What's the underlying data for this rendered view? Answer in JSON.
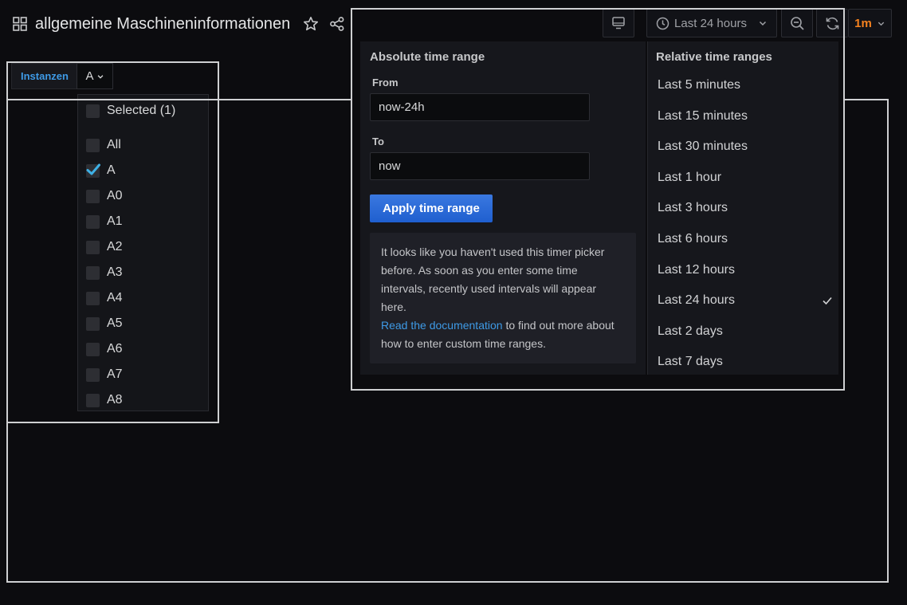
{
  "dashboard": {
    "title": "allgemeine Maschineninformationen",
    "icons": [
      "grid-icon",
      "star-icon",
      "share-icon"
    ]
  },
  "toolbar": {
    "time_range_label": "Last 24 hours",
    "refresh_interval": "1m",
    "refresh_color": "#f5821f",
    "icons": [
      "tv-icon",
      "clock-icon",
      "chevron-down-icon",
      "zoom-out-icon",
      "refresh-icon"
    ]
  },
  "variable": {
    "label": "Instanzen",
    "current_value": "A",
    "label_color": "#3e9ae6",
    "options": [
      {
        "label": "Selected (1)",
        "checked": false
      },
      {
        "label": "All",
        "checked": false
      },
      {
        "label": "A",
        "checked": true
      },
      {
        "label": "A0",
        "checked": false
      },
      {
        "label": "A1",
        "checked": false
      },
      {
        "label": "A2",
        "checked": false
      },
      {
        "label": "A3",
        "checked": false
      },
      {
        "label": "A4",
        "checked": false
      },
      {
        "label": "A5",
        "checked": false
      },
      {
        "label": "A6",
        "checked": false
      },
      {
        "label": "A7",
        "checked": false
      },
      {
        "label": "A8",
        "checked": false
      }
    ]
  },
  "time_picker": {
    "absolute_heading": "Absolute time range",
    "from_label": "From",
    "from_value": "now-24h",
    "to_label": "To",
    "to_value": "now",
    "apply_label": "Apply time range",
    "apply_color": "#3274d9",
    "info_line1": "It looks like you haven't used this timer picker",
    "info_line2": "before. As soon as you enter some time",
    "info_line3": "intervals, recently used intervals will appear",
    "info_line4": "here.",
    "info_link": "Read the documentation",
    "info_line5_rest": " to find out more about",
    "info_line6": "how to enter custom time ranges.",
    "relative_heading": "Relative time ranges",
    "relative_ranges": [
      {
        "label": "Last 5 minutes",
        "selected": false
      },
      {
        "label": "Last 15 minutes",
        "selected": false
      },
      {
        "label": "Last 30 minutes",
        "selected": false
      },
      {
        "label": "Last 1 hour",
        "selected": false
      },
      {
        "label": "Last 3 hours",
        "selected": false
      },
      {
        "label": "Last 6 hours",
        "selected": false
      },
      {
        "label": "Last 12 hours",
        "selected": false
      },
      {
        "label": "Last 24 hours",
        "selected": true
      },
      {
        "label": "Last 2 days",
        "selected": false
      },
      {
        "label": "Last 7 days",
        "selected": false
      }
    ]
  }
}
